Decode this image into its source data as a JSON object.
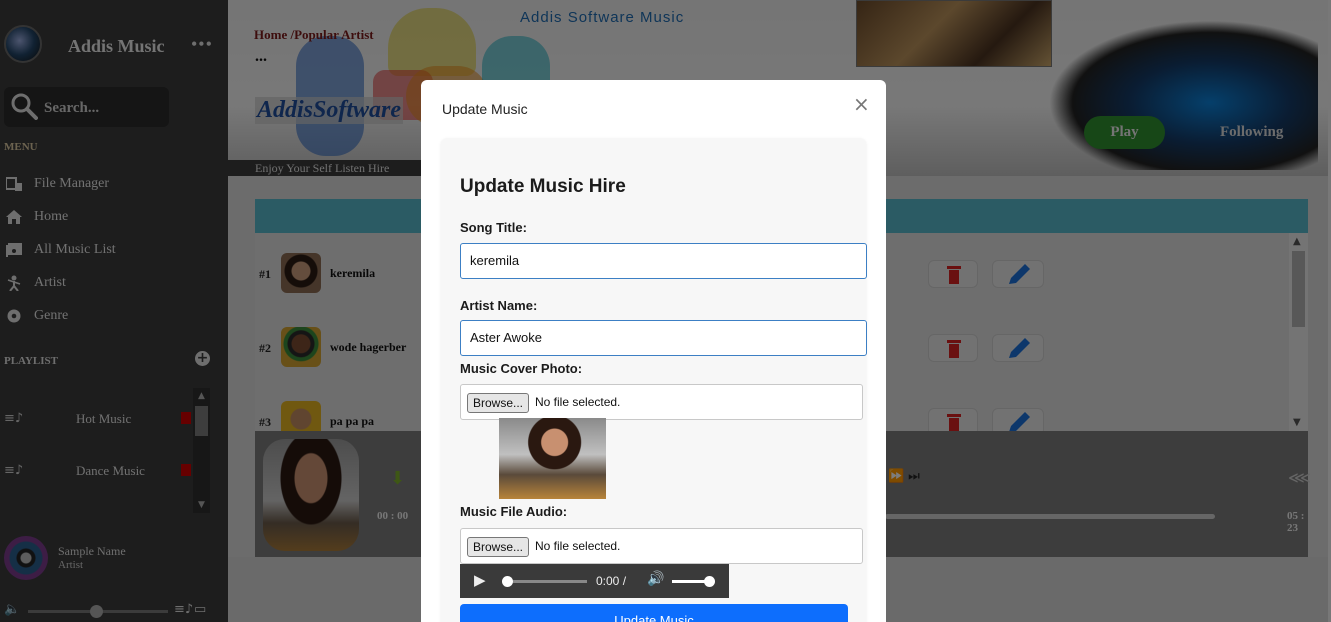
{
  "sidebar": {
    "app_name": "Addis Music",
    "more": "•••",
    "search_placeholder": "Search...",
    "menu_heading": "MENU",
    "menu_items": [
      {
        "label": "File Manager",
        "icon": "folder-icon"
      },
      {
        "label": "Home",
        "icon": "home-icon"
      },
      {
        "label": "All Music List",
        "icon": "music-list-icon"
      },
      {
        "label": "Artist",
        "icon": "artist-icon"
      },
      {
        "label": "Genre",
        "icon": "genre-icon"
      }
    ],
    "playlist_heading": "PLAYLIST",
    "playlists": [
      {
        "label": "Hot Music"
      },
      {
        "label": "Dance Music"
      }
    ],
    "now_playing": {
      "name": "Sample Name",
      "artist": "Artist"
    }
  },
  "banner": {
    "breadcrumb": "Home /Popular Artist",
    "dots": "...",
    "title": "Addis Software Music",
    "brand": "AddisSoftware",
    "play_label": "Play",
    "following_label": "Following",
    "enjoy_text": "Enjoy Your Self  Listen Hire"
  },
  "tracks": [
    {
      "num": "#1",
      "title": "keremila"
    },
    {
      "num": "#2",
      "title": "wode hagerber"
    },
    {
      "num": "#3",
      "title": "pa pa pa"
    }
  ],
  "player": {
    "current_time": "00 : 00",
    "duration": "05 : 23"
  },
  "modal": {
    "title": "Update Music",
    "close": "×",
    "heading": "Update Music Hire",
    "song_title_label": "Song Title:",
    "song_title_value": "keremila",
    "artist_name_label": "Artist Name:",
    "artist_name_value": "Aster Awoke",
    "cover_label": "Music Cover Photo:",
    "browse_label": "Browse...",
    "no_file": "No file selected.",
    "audio_label": "Music File Audio:",
    "audio_time": "0:00 /",
    "submit_label": "Update Music"
  },
  "colors": {
    "sidebar_bg": "#3a3a3a",
    "accent_teal": "#57b6c8",
    "play_green": "#2f8f2f",
    "delete_red": "#d42020",
    "edit_blue": "#1a6fd6",
    "submit_blue": "#0d6efd"
  }
}
